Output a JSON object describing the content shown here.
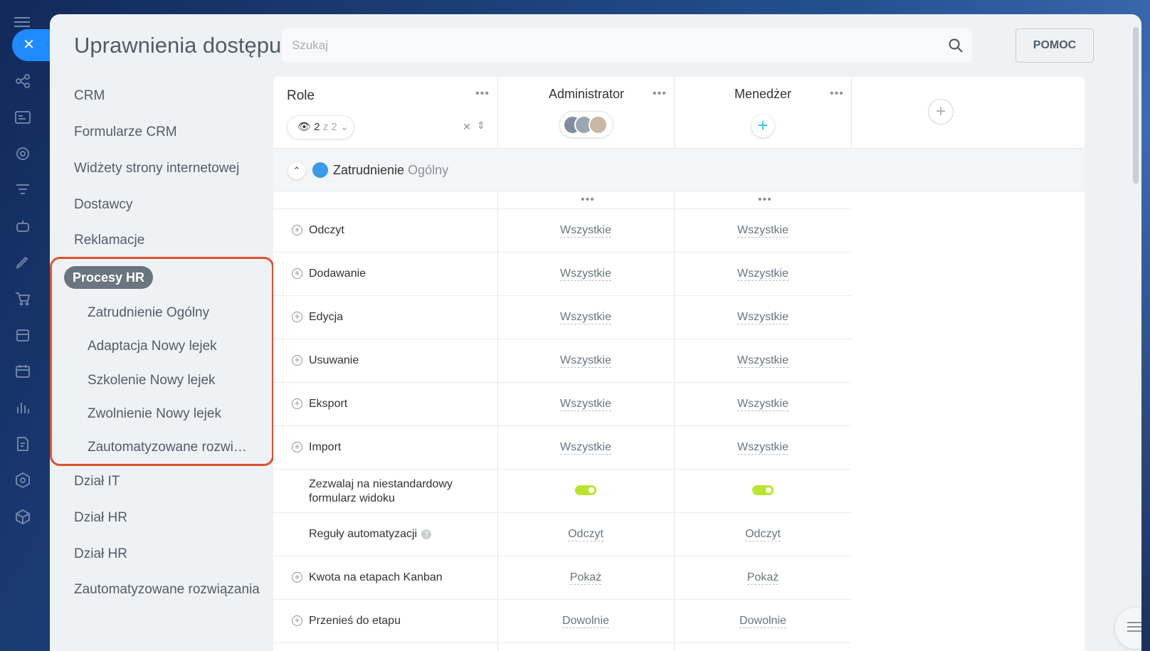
{
  "window": {
    "close_icon": "close-icon"
  },
  "header": {
    "title": "Uprawnienia dostępu",
    "search_placeholder": "Szukaj",
    "help_label": "POMOC"
  },
  "sidebar": {
    "items": [
      {
        "label": "CRM"
      },
      {
        "label": "Formularze CRM"
      },
      {
        "label": "Widżety strony internetowej"
      },
      {
        "label": "Dostawcy"
      },
      {
        "label": "Reklamacje"
      }
    ],
    "active_group": "Procesy HR",
    "sub_items": [
      {
        "label": "Zatrudnienie Ogólny"
      },
      {
        "label": "Adaptacja Nowy lejek"
      },
      {
        "label": "Szkolenie Nowy lejek"
      },
      {
        "label": "Zwolnienie Nowy lejek"
      },
      {
        "label": "Zautomatyzowane rozwiązania"
      }
    ],
    "items_after": [
      {
        "label": "Dział IT"
      },
      {
        "label": "Dział HR"
      },
      {
        "label": "Dział HR"
      },
      {
        "label": "Zautomatyzowane rozwiązania"
      }
    ]
  },
  "table": {
    "role_header": "Role",
    "filter": {
      "shown": "2",
      "total_text": "z 2"
    },
    "columns": [
      {
        "name": "Administrator"
      },
      {
        "name": "Menedżer"
      }
    ],
    "group": {
      "title": "Zatrudnienie",
      "subtitle": "Ogólny"
    },
    "rows": [
      {
        "label": "Odczyt",
        "values": [
          "Wszystkie",
          "Wszystkie"
        ]
      },
      {
        "label": "Dodawanie",
        "values": [
          "Wszystkie",
          "Wszystkie"
        ]
      },
      {
        "label": "Edycja",
        "values": [
          "Wszystkie",
          "Wszystkie"
        ]
      },
      {
        "label": "Usuwanie",
        "values": [
          "Wszystkie",
          "Wszystkie"
        ]
      },
      {
        "label": "Eksport",
        "values": [
          "Wszystkie",
          "Wszystkie"
        ]
      },
      {
        "label": "Import",
        "values": [
          "Wszystkie",
          "Wszystkie"
        ]
      },
      {
        "label": "Zezwalaj na niestandardowy formularz widoku",
        "values": [
          "on",
          "on"
        ]
      },
      {
        "label": "Reguły automatyzacji",
        "values": [
          "Odczyt",
          "Odczyt"
        ]
      },
      {
        "label": "Kwota na etapach Kanban",
        "values": [
          "Pokaż",
          "Pokaż"
        ]
      },
      {
        "label": "Przenieś do etapu",
        "values": [
          "Dowolnie",
          "Dowolnie"
        ]
      }
    ]
  },
  "colors": {
    "accent": "#1e8bff",
    "toggle_on": "#bbe42e",
    "highlight": "#e0522f"
  }
}
